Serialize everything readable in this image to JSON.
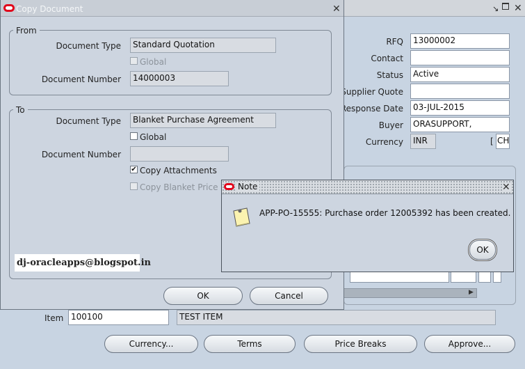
{
  "main_window": {
    "fields": [
      {
        "label": "RFQ",
        "value": "13000002"
      },
      {
        "label": "Contact",
        "value": ""
      },
      {
        "label": "Status",
        "value": "Active"
      },
      {
        "label": "Supplier Quote",
        "value": ""
      },
      {
        "label": "Response Date",
        "value": "03-JUL-2015"
      },
      {
        "label": "Buyer",
        "value": "ORASUPPORT,"
      },
      {
        "label": "Currency",
        "value": "INR"
      }
    ],
    "currency_extra": "CH",
    "item_label": "Item",
    "item_number": "100100",
    "item_description": "TEST ITEM",
    "buttons": {
      "currency": "Currency...",
      "terms": "Terms",
      "price_breaks": "Price Breaks",
      "approve": "Approve..."
    }
  },
  "copy_dialog": {
    "title": "Copy Document",
    "from": {
      "group_label": "From",
      "doc_type_label": "Document Type",
      "doc_type_value": "Standard Quotation",
      "global_label": "Global",
      "doc_number_label": "Document Number",
      "doc_number_value": "14000003"
    },
    "to": {
      "group_label": "To",
      "doc_type_label": "Document Type",
      "doc_type_value": "Blanket Purchase Agreement",
      "global_label": "Global",
      "doc_number_label": "Document Number",
      "doc_number_value": "",
      "copy_attachments_label": "Copy Attachments",
      "copy_attachments_checked": true,
      "copy_price_label": "Copy Blanket Price"
    },
    "watermark": "dj-oracleapps@blogspot.in",
    "ok_label": "OK",
    "cancel_label": "Cancel"
  },
  "note_dialog": {
    "title": "Note",
    "message": "APP-PO-15555: Purchase order 12005392 has been created.",
    "ok_label": "OK"
  },
  "colors": {
    "background": "#c8d4e2",
    "oracle_red": "#e1051b",
    "title_active": "#1c2a6e"
  },
  "icons": [
    "oracle-logo-icon",
    "close-icon",
    "minimize-icon",
    "maximize-icon",
    "note-icon",
    "checkmark-icon"
  ]
}
